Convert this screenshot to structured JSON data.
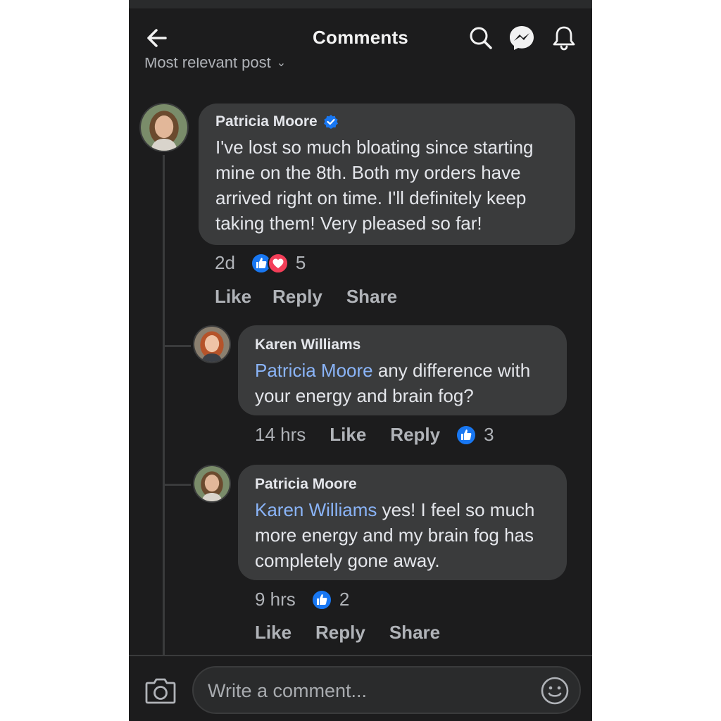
{
  "header": {
    "title": "Comments"
  },
  "sort": {
    "label": "Most relevant post"
  },
  "comments": [
    {
      "author": "Patricia Moore",
      "verified": true,
      "text": "I've lost so much bloating since starting mine on the 8th. Both my orders have arrived right on time. I'll definitely keep taking them! Very pleased so far!",
      "time": "2d",
      "reactions": [
        "like-icon",
        "love-icon"
      ],
      "reaction_count": "5",
      "actions": [
        "Like",
        "Reply",
        "Share"
      ]
    },
    {
      "author": "Karen Williams",
      "mention": "Patricia Moore",
      "text": " any difference with your energy and brain fog?",
      "time": "14 hrs",
      "actions": [
        "Like",
        "Reply"
      ],
      "reactions": [
        "like-icon"
      ],
      "reaction_count": "3"
    },
    {
      "author": "Patricia Moore",
      "mention": "Karen Williams",
      "text": " yes! I feel so much more energy and my brain fog has completely gone away.",
      "time": "9 hrs",
      "reactions": [
        "like-icon"
      ],
      "reaction_count": "2",
      "actions": [
        "Like",
        "Reply",
        "Share"
      ]
    }
  ],
  "composer": {
    "placeholder": "Write a comment..."
  },
  "colors": {
    "background": "#1c1c1d",
    "bubble": "#3a3b3c",
    "mention": "#8ab4f8",
    "like": "#1877f2",
    "love": "#f33e58"
  }
}
